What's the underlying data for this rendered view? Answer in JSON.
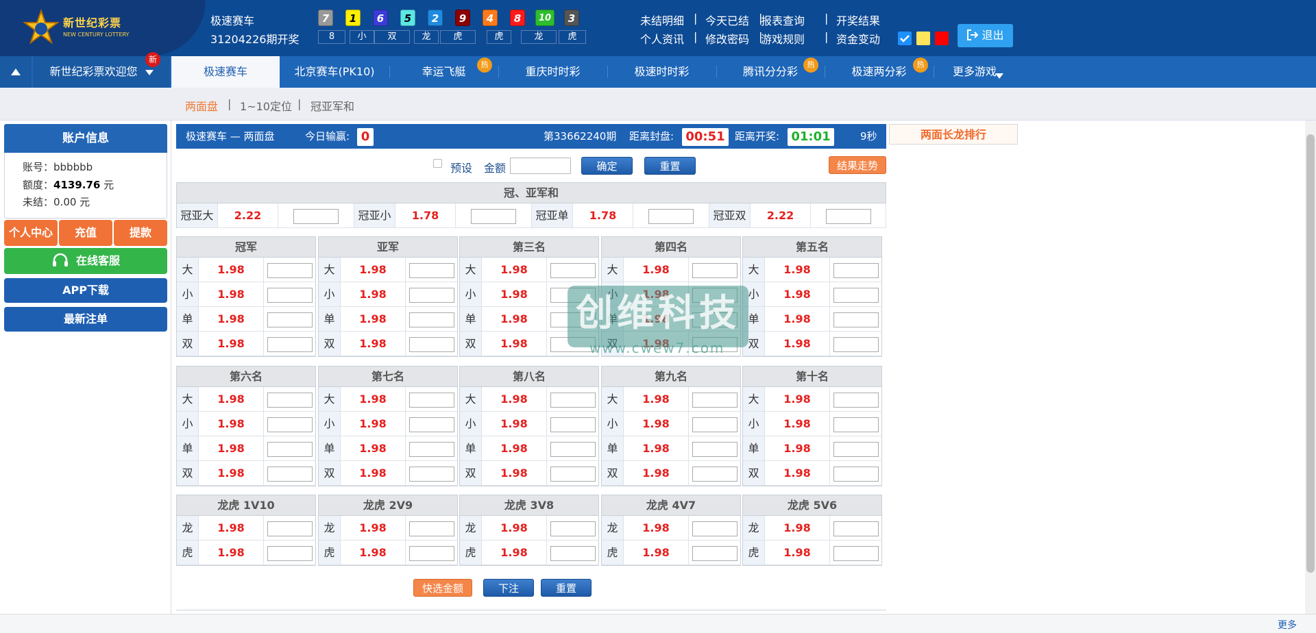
{
  "header": {
    "logo_text": "新世纪彩票",
    "logo_sub": "NEW CENTURY LOTTERY",
    "game_name": "极速赛车",
    "period_text": "31204226期开奖",
    "balls": [
      {
        "n": "7",
        "color": "#999999"
      },
      {
        "n": "1",
        "color": "#ffef00"
      },
      {
        "n": "6",
        "color": "#3b3bd6"
      },
      {
        "n": "5",
        "color": "#5ce6e6"
      },
      {
        "n": "2",
        "color": "#1f8be0"
      },
      {
        "n": "9",
        "color": "#8b0000"
      },
      {
        "n": "4",
        "color": "#ff7a1a"
      },
      {
        "n": "8",
        "color": "#ff1a1a"
      },
      {
        "n": "10",
        "color": "#2ebd2e"
      },
      {
        "n": "3",
        "color": "#555555"
      }
    ],
    "stats": [
      "8",
      "小",
      "双",
      "龙",
      "虎",
      "虎",
      "龙",
      "虎"
    ],
    "links_row1": [
      "未结明细",
      "今天已结",
      "报表查询",
      "开奖结果"
    ],
    "links_row2": [
      "个人资讯",
      "修改密码",
      "游戏规则",
      "资金变动"
    ],
    "theme_colors": [
      "#1e90ff",
      "#ffe45c",
      "#ff0000"
    ],
    "logout_label": "退出"
  },
  "nav": {
    "welcome": "新世纪彩票欢迎您",
    "new_badge": "新",
    "hot_badge": "热",
    "items": [
      "极速赛车",
      "北京赛车(PK10)",
      "幸运飞艇",
      "重庆时时彩",
      "极速时时彩",
      "腾讯分分彩",
      "极速两分彩",
      "更多游戏"
    ]
  },
  "subnav": [
    "两面盘",
    "1~10定位",
    "冠亚军和"
  ],
  "account": {
    "title": "账户信息",
    "account_label": "账号：",
    "account_value": "bbbbbb",
    "limit_label": "额度：",
    "limit_value": "4139.76",
    "limit_unit": "元",
    "unsettled_label": "未结：",
    "unsettled_value": "0.00 元",
    "buttons": [
      "个人中心",
      "充值",
      "提款"
    ],
    "service": "在线客服",
    "app": "APP下载",
    "latest": "最新注单"
  },
  "panel": {
    "title": "极速赛车 — 两面盘",
    "today_label": "今日输赢:",
    "today_value": "0",
    "period": "第33662240期",
    "close_label": "距离封盘:",
    "close_time": "00:51",
    "open_label": "距离开奖:",
    "open_time": "01:01",
    "seconds": "9秒",
    "rank": "两面长龙排行",
    "preset": "预设",
    "amount": "金额",
    "confirm": "确定",
    "reset": "重置",
    "trend": "结果走势",
    "quick": "快选金额",
    "place": "下注"
  },
  "sum_table": {
    "title": "冠、亚军和",
    "cells": [
      {
        "label": "冠亚大",
        "odds": "2.22"
      },
      {
        "label": "冠亚小",
        "odds": "1.78"
      },
      {
        "label": "冠亚单",
        "odds": "1.78"
      },
      {
        "label": "冠亚双",
        "odds": "2.22"
      }
    ]
  },
  "positions_row1": [
    "冠军",
    "亚军",
    "第三名",
    "第四名",
    "第五名"
  ],
  "positions_row2": [
    "第六名",
    "第七名",
    "第八名",
    "第九名",
    "第十名"
  ],
  "bet_labels": [
    "大",
    "小",
    "单",
    "双"
  ],
  "bet_odds": "1.98",
  "dragon_tiger": [
    "龙虎 1V10",
    "龙虎 2V9",
    "龙虎 3V8",
    "龙虎 4V7",
    "龙虎 5V6"
  ],
  "dt_labels": [
    "龙",
    "虎"
  ],
  "watermark": "创维科技",
  "watermark_url": "www.cwew7.com",
  "footer_more": "更多"
}
